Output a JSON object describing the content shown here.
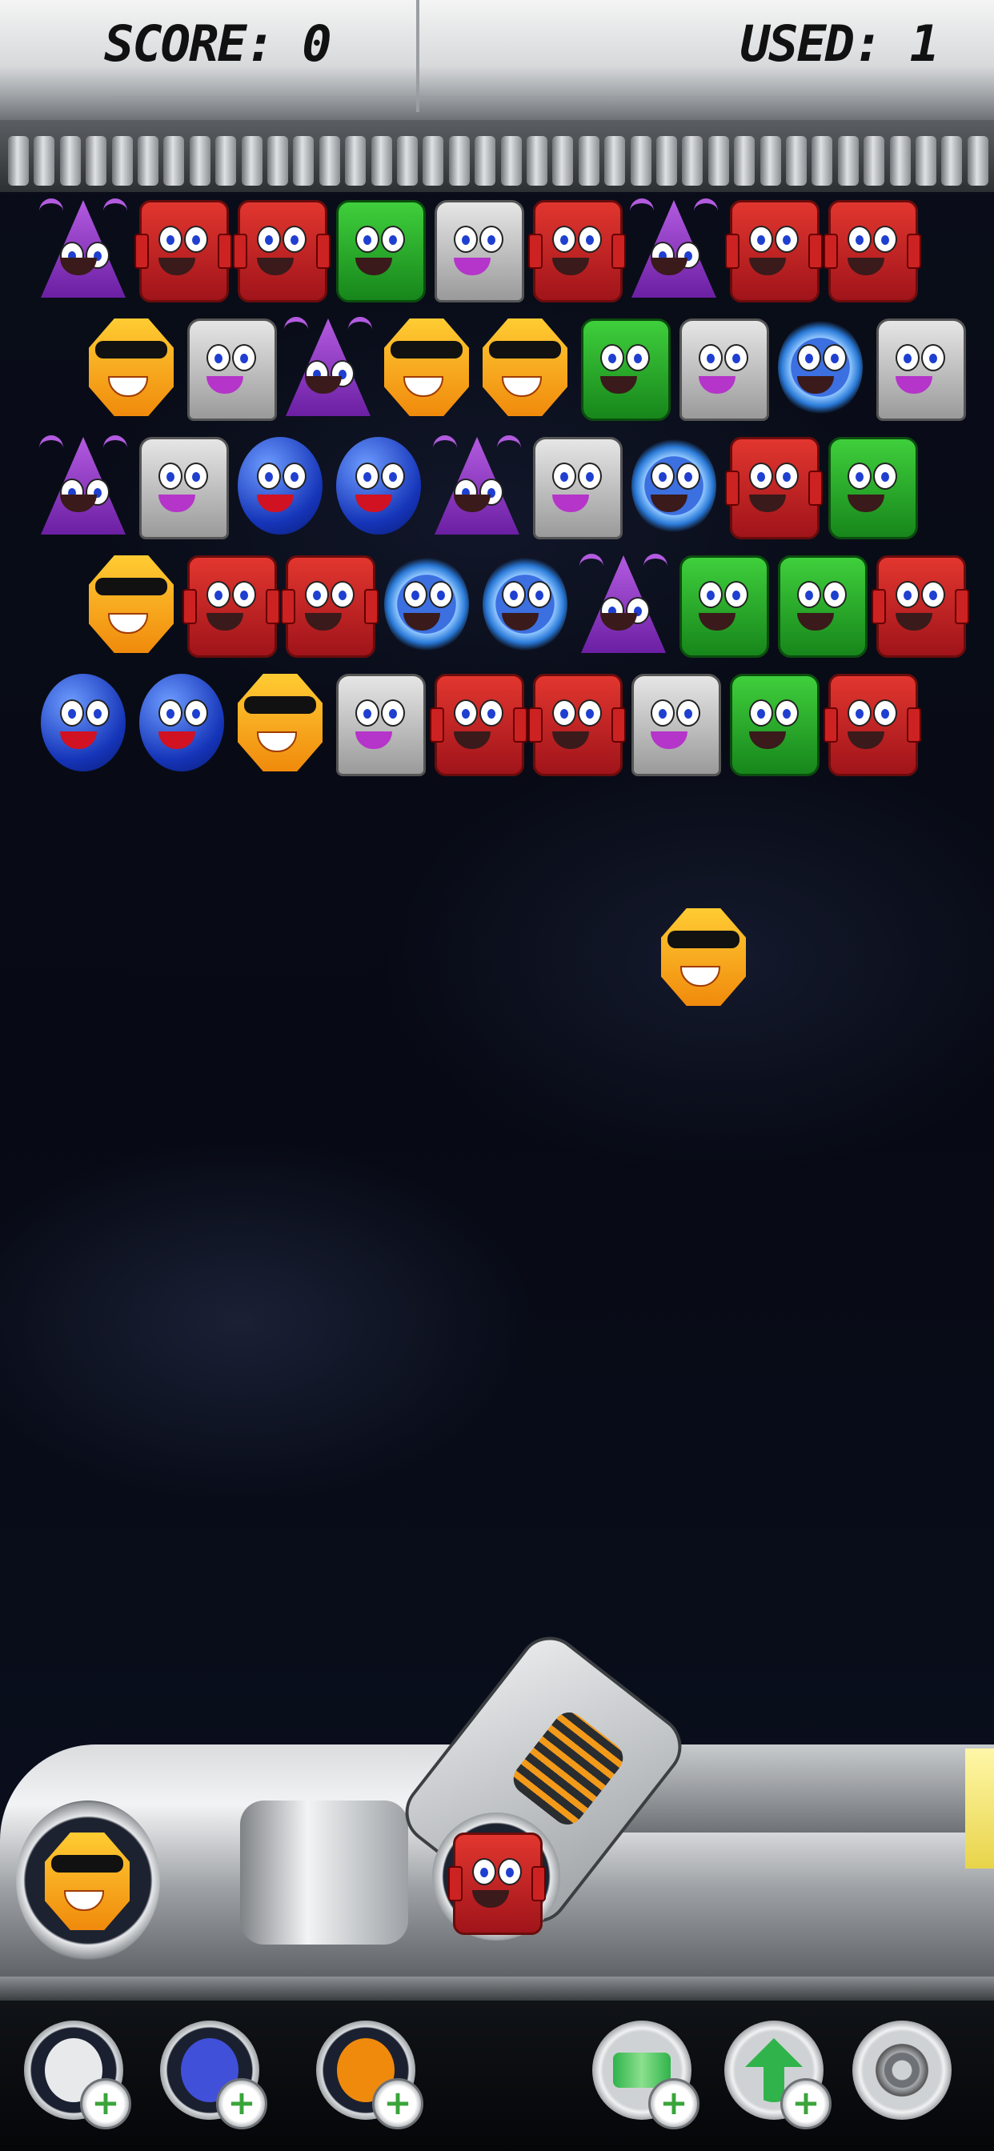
{
  "hud": {
    "score_label": "SCORE: 0",
    "used_label": "USED: 1"
  },
  "powerups": [
    {
      "icon": "bomb-character-icon",
      "plus": "+"
    },
    {
      "icon": "jester-character-icon",
      "plus": "+"
    },
    {
      "icon": "orange-character-icon",
      "plus": "+"
    },
    {
      "icon": "shuffle-icon",
      "plus": "+"
    },
    {
      "icon": "arrow-up-icon",
      "plus": "+"
    },
    {
      "icon": "gear-icon"
    }
  ],
  "grid": [
    [
      "purple",
      "red",
      "red",
      "green",
      "grey",
      "red",
      "purple",
      "red",
      "red"
    ],
    [
      "orange",
      "grey",
      "purple",
      "orange",
      "orange",
      "green",
      "grey",
      "spiky",
      "grey"
    ],
    [
      "purple",
      "grey",
      "blue",
      "blue",
      "purple",
      "grey",
      "spiky",
      "red",
      "green"
    ],
    [
      "orange",
      "red",
      "red",
      "spiky",
      "spiky",
      "purple",
      "green",
      "green",
      "red"
    ],
    [
      "blue",
      "blue",
      "orange",
      "grey",
      "red",
      "red",
      "grey",
      "green",
      "red"
    ]
  ],
  "flying_bubble": "orange",
  "next_bubble": "orange",
  "current_bubble": "red"
}
